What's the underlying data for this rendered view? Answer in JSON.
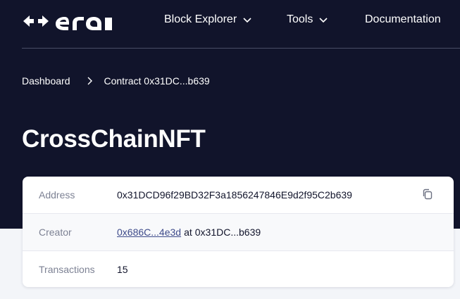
{
  "header": {
    "logo_alt": "era",
    "nav": [
      {
        "label": "Block Explorer",
        "has_dropdown": true
      },
      {
        "label": "Tools",
        "has_dropdown": true
      },
      {
        "label": "Documentation",
        "has_dropdown": false
      }
    ]
  },
  "breadcrumb": {
    "items": [
      "Dashboard",
      "Contract 0x31DC...b639"
    ]
  },
  "page": {
    "title": "CrossChainNFT"
  },
  "contract": {
    "address_label": "Address",
    "address_value": "0x31DCD96f29BD32F3a1856247846E9d2f95C2b639",
    "creator_label": "Creator",
    "creator_link": "0x686C...4e3d",
    "creator_at": "at",
    "creator_tx": "0x31DC...b639",
    "transactions_label": "Transactions",
    "transactions_value": "15"
  },
  "colors": {
    "hero_bg": "#11142b",
    "page_bg": "#f3f5f9",
    "link": "#3d4a8a",
    "label": "#7d8294"
  }
}
